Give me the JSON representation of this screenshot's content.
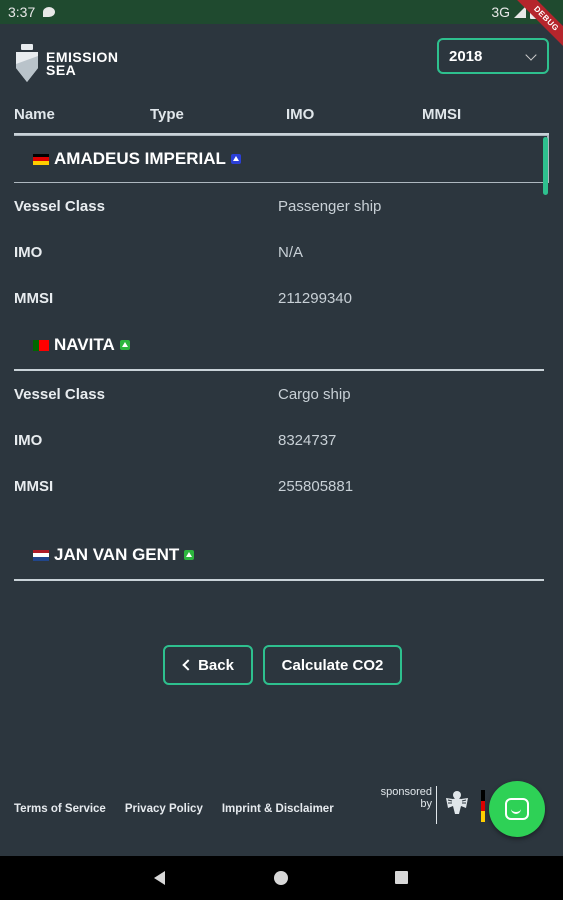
{
  "status_bar": {
    "time": "3:37",
    "network": "3G",
    "debug_label": "DEBUG"
  },
  "header": {
    "logo_line1": "EMISSION",
    "logo_line2": "SEA",
    "year_selected": "2018"
  },
  "columns": [
    "Name",
    "Type",
    "IMO",
    "MMSI"
  ],
  "ships": [
    {
      "name": "AMADEUS IMPERIAL",
      "flag": "germany",
      "badge_color": "#2b3fd6",
      "fields": [
        {
          "label": "Vessel Class",
          "value": "Passenger ship"
        },
        {
          "label": "IMO",
          "value": "N/A"
        },
        {
          "label": "MMSI",
          "value": "211299340"
        }
      ]
    },
    {
      "name": "NAVITA",
      "flag": "portugal",
      "badge_color": "#2db53e",
      "fields": [
        {
          "label": "Vessel Class",
          "value": "Cargo ship"
        },
        {
          "label": "IMO",
          "value": "8324737"
        },
        {
          "label": "MMSI",
          "value": "255805881"
        }
      ]
    },
    {
      "name": "JAN VAN GENT",
      "flag": "netherlands",
      "badge_color": "#2db53e",
      "fields": []
    }
  ],
  "buttons": {
    "back": "Back",
    "calculate": "Calculate CO2"
  },
  "footer": {
    "terms": "Terms of Service",
    "privacy": "Privacy Policy",
    "imprint": "Imprint & Disclaimer",
    "sponsored_line1": "sponsored",
    "sponsored_line2": "by"
  },
  "colors": {
    "background": "#2c363e",
    "accent": "#2ec08e",
    "status_bar": "#1f4a2f",
    "chat_fab": "#2ed156"
  }
}
